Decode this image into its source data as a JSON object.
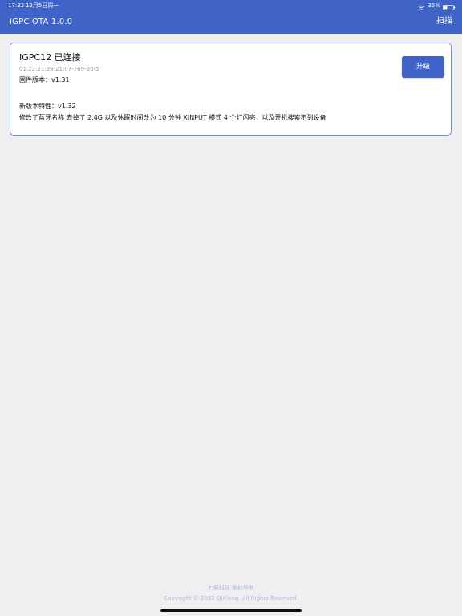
{
  "status_bar": {
    "time": "17:32",
    "date": "12月5日周一",
    "battery_percent": "35%",
    "battery_level": 0.35,
    "icons": [
      "wifi-icon",
      "battery-icon"
    ]
  },
  "app_bar": {
    "title": "IGPC OTA 1.0.0",
    "scan_label": "扫描",
    "background": "#3f63c6"
  },
  "device_card": {
    "name": "IGPC12 已连接",
    "mac": "01:22:21:39:21:07-769-30-5",
    "firmware": "固件版本：v1.31",
    "upgrade_label": "升级",
    "feature_title": "新版本特性：v1.32",
    "feature_description": "修改了蓝牙名称  去掉了 2.4G  以及休眠时间改为 10 分钟 XINPUT 模式 4 个灯闪亮，以及开机搜索不到设备",
    "border_color": "#6b8de6"
  },
  "footer": {
    "company": "七振科技 版权所有",
    "copyright": "Copyright © 2022 QiXieng. All Rights Reserved."
  },
  "colors": {
    "page_background": "#efeff0",
    "accent": "#3f63c6",
    "footer_text": "#aebbdd"
  }
}
